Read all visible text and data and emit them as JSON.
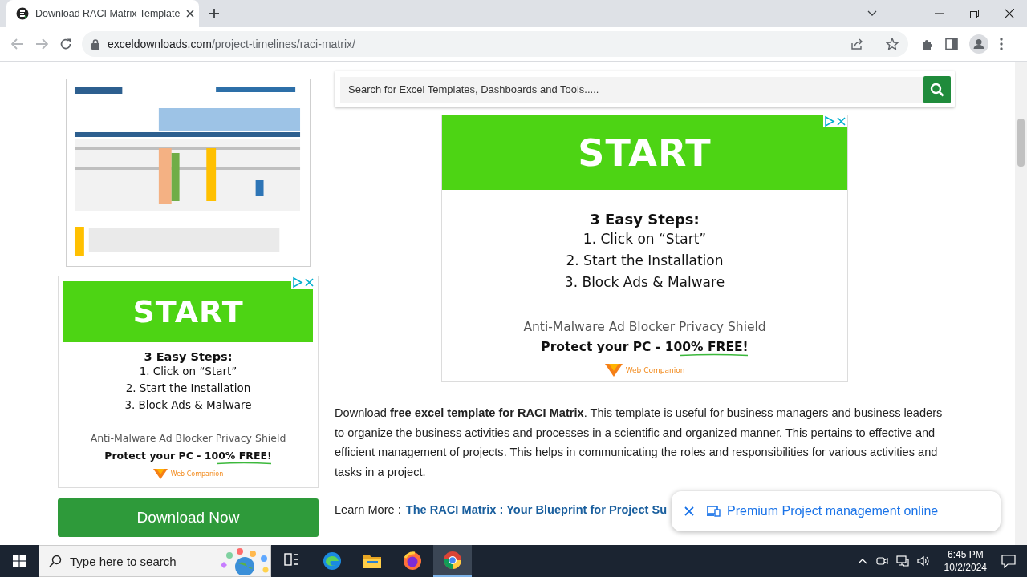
{
  "browser": {
    "tab": {
      "title": "Download RACI Matrix Template",
      "selected": true
    },
    "address": {
      "domain": "exceldownloads.com",
      "path": "/project-timelines/raci-matrix/"
    }
  },
  "sidebar": {
    "ad": {
      "headline": "START",
      "steps_title": "3 Easy Steps:",
      "steps": [
        "1. Click on “Start”",
        "2. Start the Installation",
        "3. Block Ads & Malware"
      ],
      "tagline": "Anti-Malware Ad Blocker Privacy Shield",
      "offer": "Protect your PC - 100% FREE!",
      "brand": "Web Companion"
    },
    "download_button": "Download Now"
  },
  "main": {
    "search": {
      "placeholder": "Search for Excel Templates, Dashboards and Tools....."
    },
    "ad": {
      "headline": "START",
      "steps_title": "3 Easy Steps:",
      "steps": [
        "1. Click on “Start”",
        "2. Start the Installation",
        "3. Block Ads & Malware"
      ],
      "tagline": "Anti-Malware Ad Blocker Privacy Shield",
      "offer": "Protect your PC - 100% FREE!",
      "brand": "Web Companion"
    },
    "description": "Download **free excel template for RACI Matrix**. This template is useful for business managers and business leaders to organize the business activities and processes in a scientific and organized manner. This pertains to effective and efficient management of projects. This helps in communicating the roles and responsibilities for various activities and tasks in a project.",
    "learn_more": {
      "label": "Learn More :",
      "link": "The RACI Matrix : Your Blueprint for Project Su"
    }
  },
  "popup": {
    "text": "Premium Project management online"
  },
  "taskbar": {
    "search_placeholder": "Type here to search",
    "apps": [
      {
        "kind": "taskview",
        "selected": false
      },
      {
        "kind": "edge",
        "selected": false
      },
      {
        "kind": "explorer",
        "selected": false
      },
      {
        "kind": "firefox",
        "selected": false
      },
      {
        "kind": "chrome",
        "selected": true
      }
    ],
    "time": "6:45 PM",
    "date": "10/2/2024"
  }
}
